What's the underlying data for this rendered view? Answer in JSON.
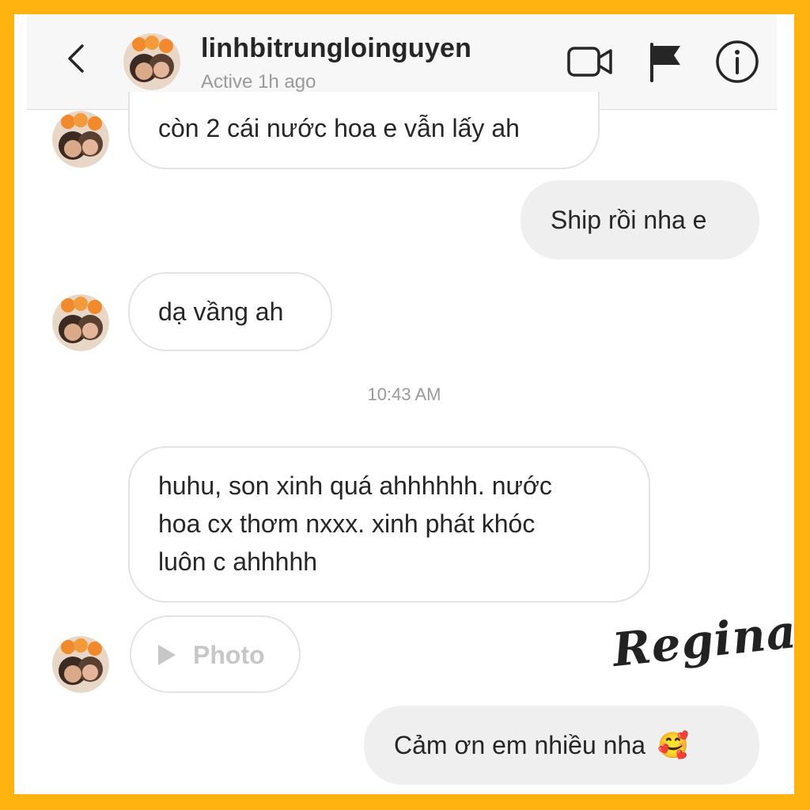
{
  "header": {
    "username": "linhbitrungloinguyen",
    "status": "Active 1h ago",
    "icons": {
      "back": "back-chevron-icon",
      "video": "video-camera-icon",
      "flag": "flag-icon",
      "info": "info-icon"
    }
  },
  "messages": {
    "m1": "còn 2 cái nước hoa e vẫn lấy ah",
    "m2": "Ship rồi nha e",
    "m3": "dạ vầng ah",
    "timestamp": "10:43 AM",
    "m4_line1": "huhu, son xinh quá ahhhhhh. nước",
    "m4_line2": "hoa cx thơm nxxx. xinh phát khóc",
    "m4_line3": "luôn c ahhhhh",
    "photo_label": "Photo",
    "m5": "Cảm ơn em nhiều nha",
    "m5_emoji": "🥰"
  },
  "watermark": "Regina",
  "colors": {
    "frame": "#FFB30F",
    "bubble_out": "#efefef",
    "bubble_border": "#e3e3e3",
    "text": "#262626",
    "muted": "#9a9a9a"
  }
}
